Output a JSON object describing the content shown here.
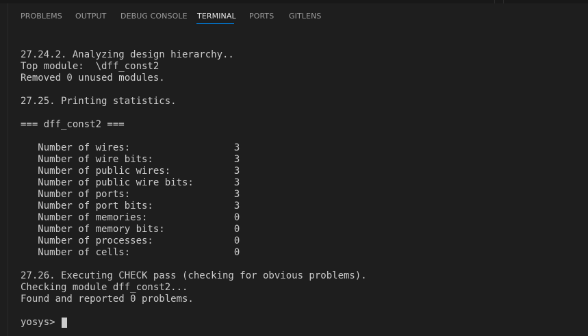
{
  "panel": {
    "tabs": [
      {
        "label": "PROBLEMS"
      },
      {
        "label": "OUTPUT"
      },
      {
        "label": "DEBUG CONSOLE"
      },
      {
        "label": "TERMINAL"
      },
      {
        "label": "PORTS"
      },
      {
        "label": "GITLENS"
      }
    ],
    "active_tab": "TERMINAL"
  },
  "terminal": {
    "lines": [
      "27.24.2. Analyzing design hierarchy..",
      "Top module:  \\dff_const2",
      "Removed 0 unused modules.",
      "",
      "27.25. Printing statistics.",
      "",
      "=== dff_const2 ===",
      "",
      "   Number of wires:                  3",
      "   Number of wire bits:              3",
      "   Number of public wires:           3",
      "   Number of public wire bits:       3",
      "   Number of ports:                  3",
      "   Number of port bits:              3",
      "   Number of memories:               0",
      "   Number of memory bits:            0",
      "   Number of processes:              0",
      "   Number of cells:                  0",
      "",
      "27.26. Executing CHECK pass (checking for obvious problems).",
      "Checking module dff_const2...",
      "Found and reported 0 problems.",
      ""
    ],
    "prompt": "yosys> "
  }
}
